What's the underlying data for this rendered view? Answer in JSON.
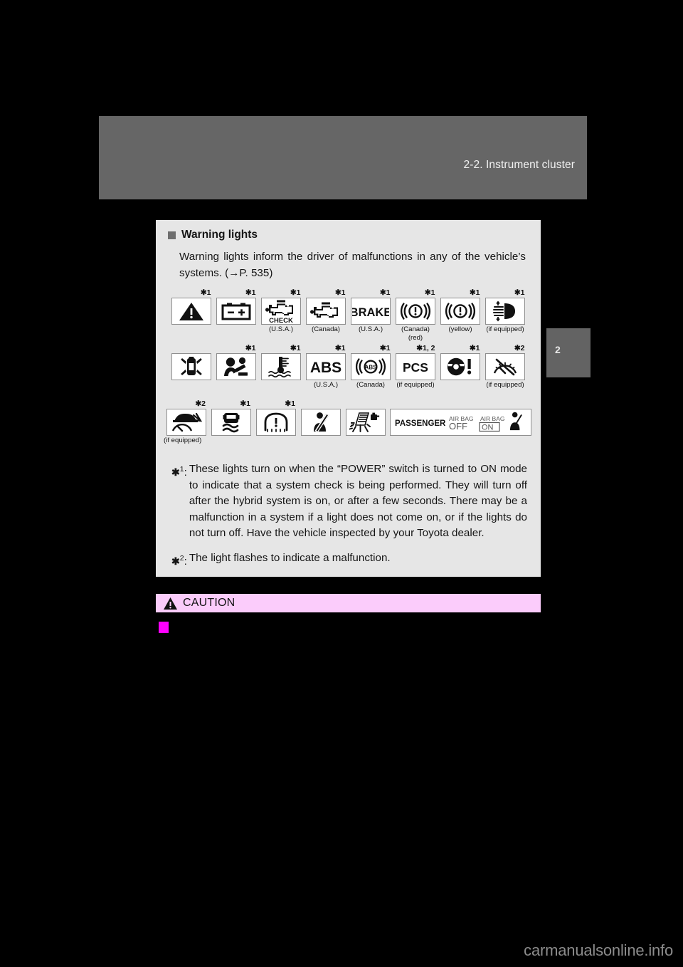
{
  "header": {
    "title": "2-2. Instrument cluster"
  },
  "chapter_tab": {
    "number": "2"
  },
  "section": {
    "bullet_icon": "square-bullet-icon",
    "heading": "Warning lights",
    "body": "Warning lights inform the driver of malfunctions in any of the vehicle’s systems. (→P. 535)"
  },
  "icon_rows": [
    {
      "row_id": "row-1",
      "cells": [
        {
          "icon": "master-warning-triangle-icon",
          "star": "✱︎1",
          "caption": "",
          "caption2": ""
        },
        {
          "icon": "battery-charge-warning-icon",
          "star": "✱︎1",
          "caption": "",
          "caption2": ""
        },
        {
          "icon": "check-engine-usa-icon",
          "star": "✱︎1",
          "caption": "(U.S.A.)",
          "caption2": ""
        },
        {
          "icon": "check-engine-canada-icon",
          "star": "✱︎1",
          "caption": "(Canada)",
          "caption2": ""
        },
        {
          "icon": "brake-system-usa-icon",
          "star": "✱︎1",
          "caption": "(U.S.A.)",
          "caption2": ""
        },
        {
          "icon": "brake-system-canada-red-icon",
          "star": "✱︎1",
          "caption": "(Canada)",
          "caption2": "(red)"
        },
        {
          "icon": "brake-system-yellow-icon",
          "star": "✱︎1",
          "caption": "(yellow)",
          "caption2": ""
        },
        {
          "icon": "headlight-auto-leveling-icon",
          "star": "✱︎1",
          "caption": "(if equipped)",
          "caption2": ""
        }
      ]
    },
    {
      "row_id": "row-2",
      "cells": [
        {
          "icon": "electric-power-steering-icon",
          "star": "",
          "caption": "",
          "caption2": ""
        },
        {
          "icon": "srs-airbag-warning-icon",
          "star": "✱︎1",
          "caption": "",
          "caption2": ""
        },
        {
          "icon": "engine-coolant-temp-icon",
          "star": "✱︎1",
          "caption": "",
          "caption2": ""
        },
        {
          "icon": "abs-usa-icon",
          "star": "✱︎1",
          "caption": "(U.S.A.)",
          "caption2": ""
        },
        {
          "icon": "abs-canada-icon",
          "star": "✱︎1",
          "caption": "(Canada)",
          "caption2": ""
        },
        {
          "icon": "pcs-warning-icon",
          "star": "✱︎1, 2",
          "caption": "(if equipped)",
          "caption2": ""
        },
        {
          "icon": "lkas-steering-warning-icon",
          "star": "✱︎1",
          "caption": "",
          "caption2": ""
        },
        {
          "icon": "radar-cruise-control-icon",
          "star": "✱︎2",
          "caption": "(if equipped)",
          "caption2": ""
        }
      ]
    },
    {
      "row_id": "row-3",
      "cells": [
        {
          "icon": "dynamic-radar-cruise-malfunction-icon",
          "star": "✱︎2",
          "caption": "(if equipped)",
          "caption2": ""
        },
        {
          "icon": "slip-indicator-vsc-icon",
          "star": "✱︎1",
          "caption": "",
          "caption2": ""
        },
        {
          "icon": "tire-pressure-warning-icon",
          "star": "✱︎1",
          "caption": "",
          "caption2": ""
        },
        {
          "icon": "driver-seat-belt-reminder-icon",
          "star": "",
          "caption": "",
          "caption2": ""
        },
        {
          "icon": "low-fuel-level-icon",
          "star": "",
          "caption": "",
          "caption2": ""
        },
        {
          "icon": "passenger-airbag-indicator-icon",
          "star": "",
          "caption": "",
          "caption2": ""
        }
      ]
    }
  ],
  "icon_text": {
    "check_label": "CHECK",
    "brake_label": "BRAKE",
    "abs_label": "ABS",
    "abs_small_label": "ABS",
    "pcs_label": "PCS",
    "passenger_label": "PASSENGER",
    "airbag_label_1": "AIR BAG",
    "airbag_off": "OFF",
    "airbag_label_2": "AIR BAG",
    "airbag_on": "ON"
  },
  "footnotes": [
    {
      "mark_star": "✱︎",
      "mark_num": "1",
      "mark_sep": ":",
      "text": "These lights turn on when the “POWER” switch is turned to ON mode to indicate that a system check is being performed. They will turn off after the hybrid system is on, or after a few seconds. There may be a malfunction in a system if a light does not come on, or if the lights do not turn off. Have the vehicle inspected by your Toyota dealer."
    },
    {
      "mark_star": "✱︎",
      "mark_num": "2",
      "mark_sep": ":",
      "text": "The light flashes to indicate a malfunction."
    }
  ],
  "caution": {
    "icon": "caution-triangle-icon",
    "label": "CAUTION",
    "bullet_icon": "magenta-square-bullet-icon"
  },
  "watermark": {
    "text": "carmanualsonline.info"
  },
  "colors": {
    "page_background": "#000000",
    "header_band": "#666666",
    "content_panel": "#e6e6e6",
    "caution_bar": "#fbccfb",
    "caution_bullet": "#ff00ff",
    "chapter_tab": "#636363",
    "watermark": "#8c8c8c"
  }
}
